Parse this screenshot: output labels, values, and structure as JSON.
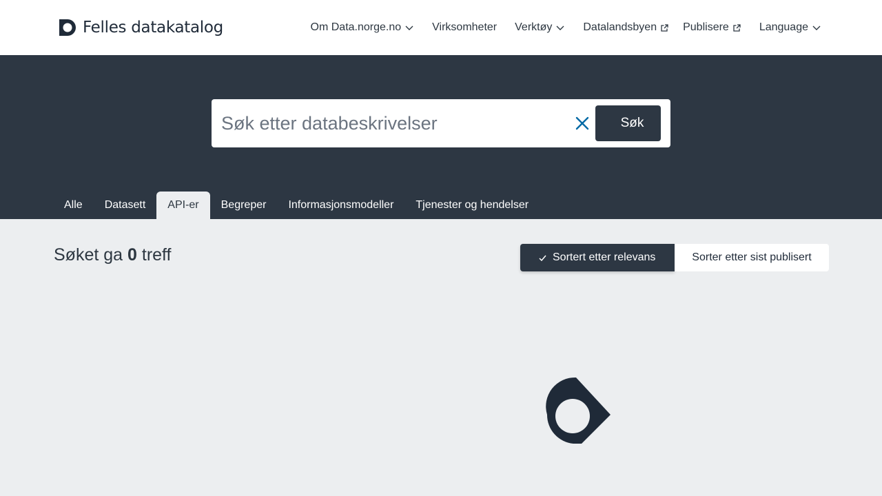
{
  "header": {
    "logo_text": "Felles datakatalog",
    "nav": [
      {
        "label": "Om Data.norge.no",
        "icon": "chevron-down-icon"
      },
      {
        "label": "Virksomheter"
      },
      {
        "label": "Verktøy",
        "icon": "chevron-down-icon"
      },
      {
        "label": "Datalandsbyen",
        "icon": "external-link-icon"
      },
      {
        "label": "Publisere",
        "icon": "external-link-icon"
      },
      {
        "label": "Language",
        "icon": "chevron-down-icon"
      }
    ]
  },
  "search": {
    "placeholder": "Søk etter databeskrivelser",
    "value": "",
    "button_label": "Søk"
  },
  "tabs": [
    {
      "label": "Alle",
      "active": false
    },
    {
      "label": "Datasett",
      "active": false
    },
    {
      "label": "API-er",
      "active": true
    },
    {
      "label": "Begreper",
      "active": false
    },
    {
      "label": "Informasjonsmodeller",
      "active": false
    },
    {
      "label": "Tjenester og hendelser",
      "active": false
    }
  ],
  "results": {
    "prefix": "Søket ga",
    "count": "0",
    "suffix": "treff"
  },
  "sort": {
    "active_label": "Sortert etter relevans",
    "other_label": "Sorter etter sist publisert"
  },
  "colors": {
    "dark": "#2d3743",
    "background": "#eceef0",
    "clear_icon": "#0069a5"
  }
}
